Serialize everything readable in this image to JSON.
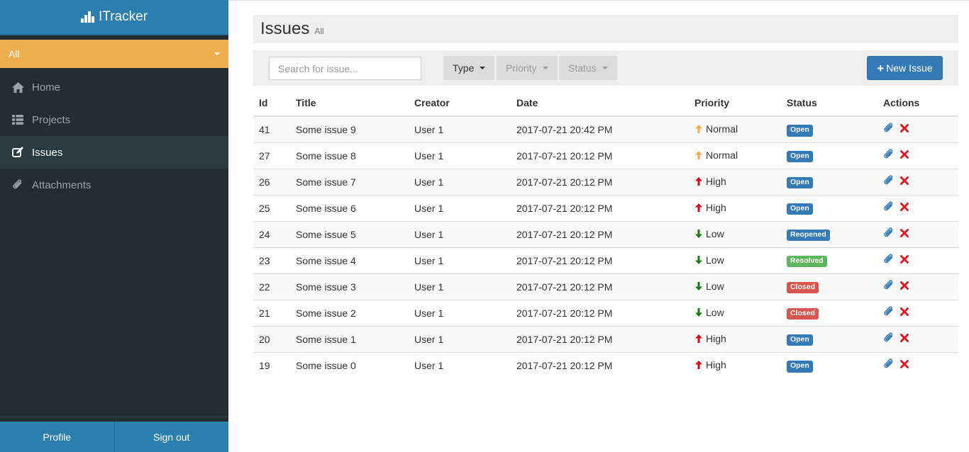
{
  "app": {
    "title": "ITracker"
  },
  "sidebar": {
    "project_select": "All",
    "items": [
      {
        "label": "Home",
        "icon": "home-icon"
      },
      {
        "label": "Projects",
        "icon": "list-icon"
      },
      {
        "label": "Issues",
        "icon": "edit-icon",
        "active": true
      },
      {
        "label": "Attachments",
        "icon": "paperclip-icon"
      }
    ],
    "footer": {
      "profile": "Profile",
      "signout": "Sign out"
    }
  },
  "header": {
    "title": "Issues",
    "subtitle": "All"
  },
  "toolbar": {
    "search_placeholder": "Search for issue...",
    "type": "Type",
    "priority": "Priority",
    "status": "Status",
    "new_issue": "New Issue"
  },
  "table": {
    "columns": [
      "Id",
      "Title",
      "Creator",
      "Date",
      "Priority",
      "Status",
      "Actions"
    ],
    "rows": [
      {
        "id": "41",
        "title": "Some issue 9",
        "creator": "User 1",
        "date": "2017-07-21 20:42 PM",
        "priority": "Normal",
        "status": "Open"
      },
      {
        "id": "27",
        "title": "Some issue 8",
        "creator": "User 1",
        "date": "2017-07-21 20:12 PM",
        "priority": "Normal",
        "status": "Open"
      },
      {
        "id": "26",
        "title": "Some issue 7",
        "creator": "User 1",
        "date": "2017-07-21 20:12 PM",
        "priority": "High",
        "status": "Open"
      },
      {
        "id": "25",
        "title": "Some issue 6",
        "creator": "User 1",
        "date": "2017-07-21 20:12 PM",
        "priority": "High",
        "status": "Open"
      },
      {
        "id": "24",
        "title": "Some issue 5",
        "creator": "User 1",
        "date": "2017-07-21 20:12 PM",
        "priority": "Low",
        "status": "Reopened"
      },
      {
        "id": "23",
        "title": "Some issue 4",
        "creator": "User 1",
        "date": "2017-07-21 20:12 PM",
        "priority": "Low",
        "status": "Resolved"
      },
      {
        "id": "22",
        "title": "Some issue 3",
        "creator": "User 1",
        "date": "2017-07-21 20:12 PM",
        "priority": "Low",
        "status": "Closed"
      },
      {
        "id": "21",
        "title": "Some issue 2",
        "creator": "User 1",
        "date": "2017-07-21 20:12 PM",
        "priority": "Low",
        "status": "Closed"
      },
      {
        "id": "20",
        "title": "Some issue 1",
        "creator": "User 1",
        "date": "2017-07-21 20:12 PM",
        "priority": "High",
        "status": "Open"
      },
      {
        "id": "19",
        "title": "Some issue 0",
        "creator": "User 1",
        "date": "2017-07-21 20:12 PM",
        "priority": "High",
        "status": "Open"
      }
    ]
  },
  "colors": {
    "brand": "#2a7fae",
    "project_select": "#f0ad4e",
    "sidebar_bg": "#222d32",
    "priority": {
      "Normal": "#f0ad4e",
      "High": "#d9091b",
      "Low": "#1a7a1a"
    },
    "status": {
      "Open": "#337ab7",
      "Reopened": "#337ab7",
      "Resolved": "#5cb85c",
      "Closed": "#d9534f"
    }
  }
}
